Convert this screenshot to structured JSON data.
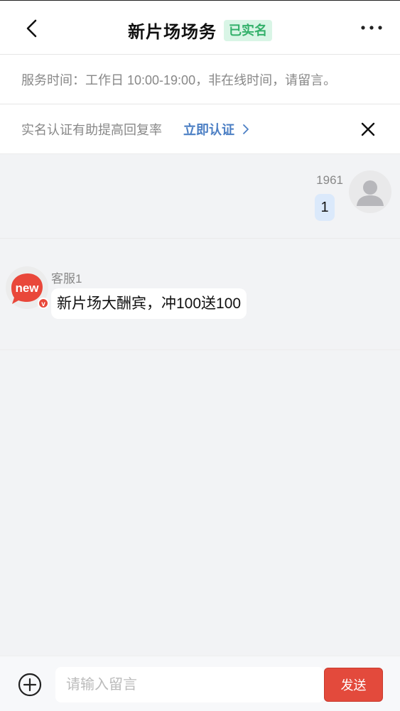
{
  "header": {
    "title": "新片场场务",
    "badge": "已实名",
    "back_icon": "chevron-left-icon",
    "more_icon": "more-horizontal-icon"
  },
  "service_notice": {
    "text": "服务时间：工作日 10:00-19:00，非在线时间，请留言。"
  },
  "verify_tip": {
    "text": "实名认证有助提高回复率",
    "link_label": "立即认证",
    "link_color": "#4c7fc4",
    "close_icon": "close-icon"
  },
  "messages": [
    {
      "sender": "1961",
      "text": "1",
      "is_self": true
    },
    {
      "sender": "客服1",
      "text": "新片场大酬宾，冲100送100",
      "is_self": false,
      "avatar_logo": "new",
      "verified_mark": "v"
    }
  ],
  "composer": {
    "placeholder": "请输入留言",
    "send_label": "发送",
    "send_color": "#e34a3c",
    "plus_icon": "plus-circle-icon"
  }
}
